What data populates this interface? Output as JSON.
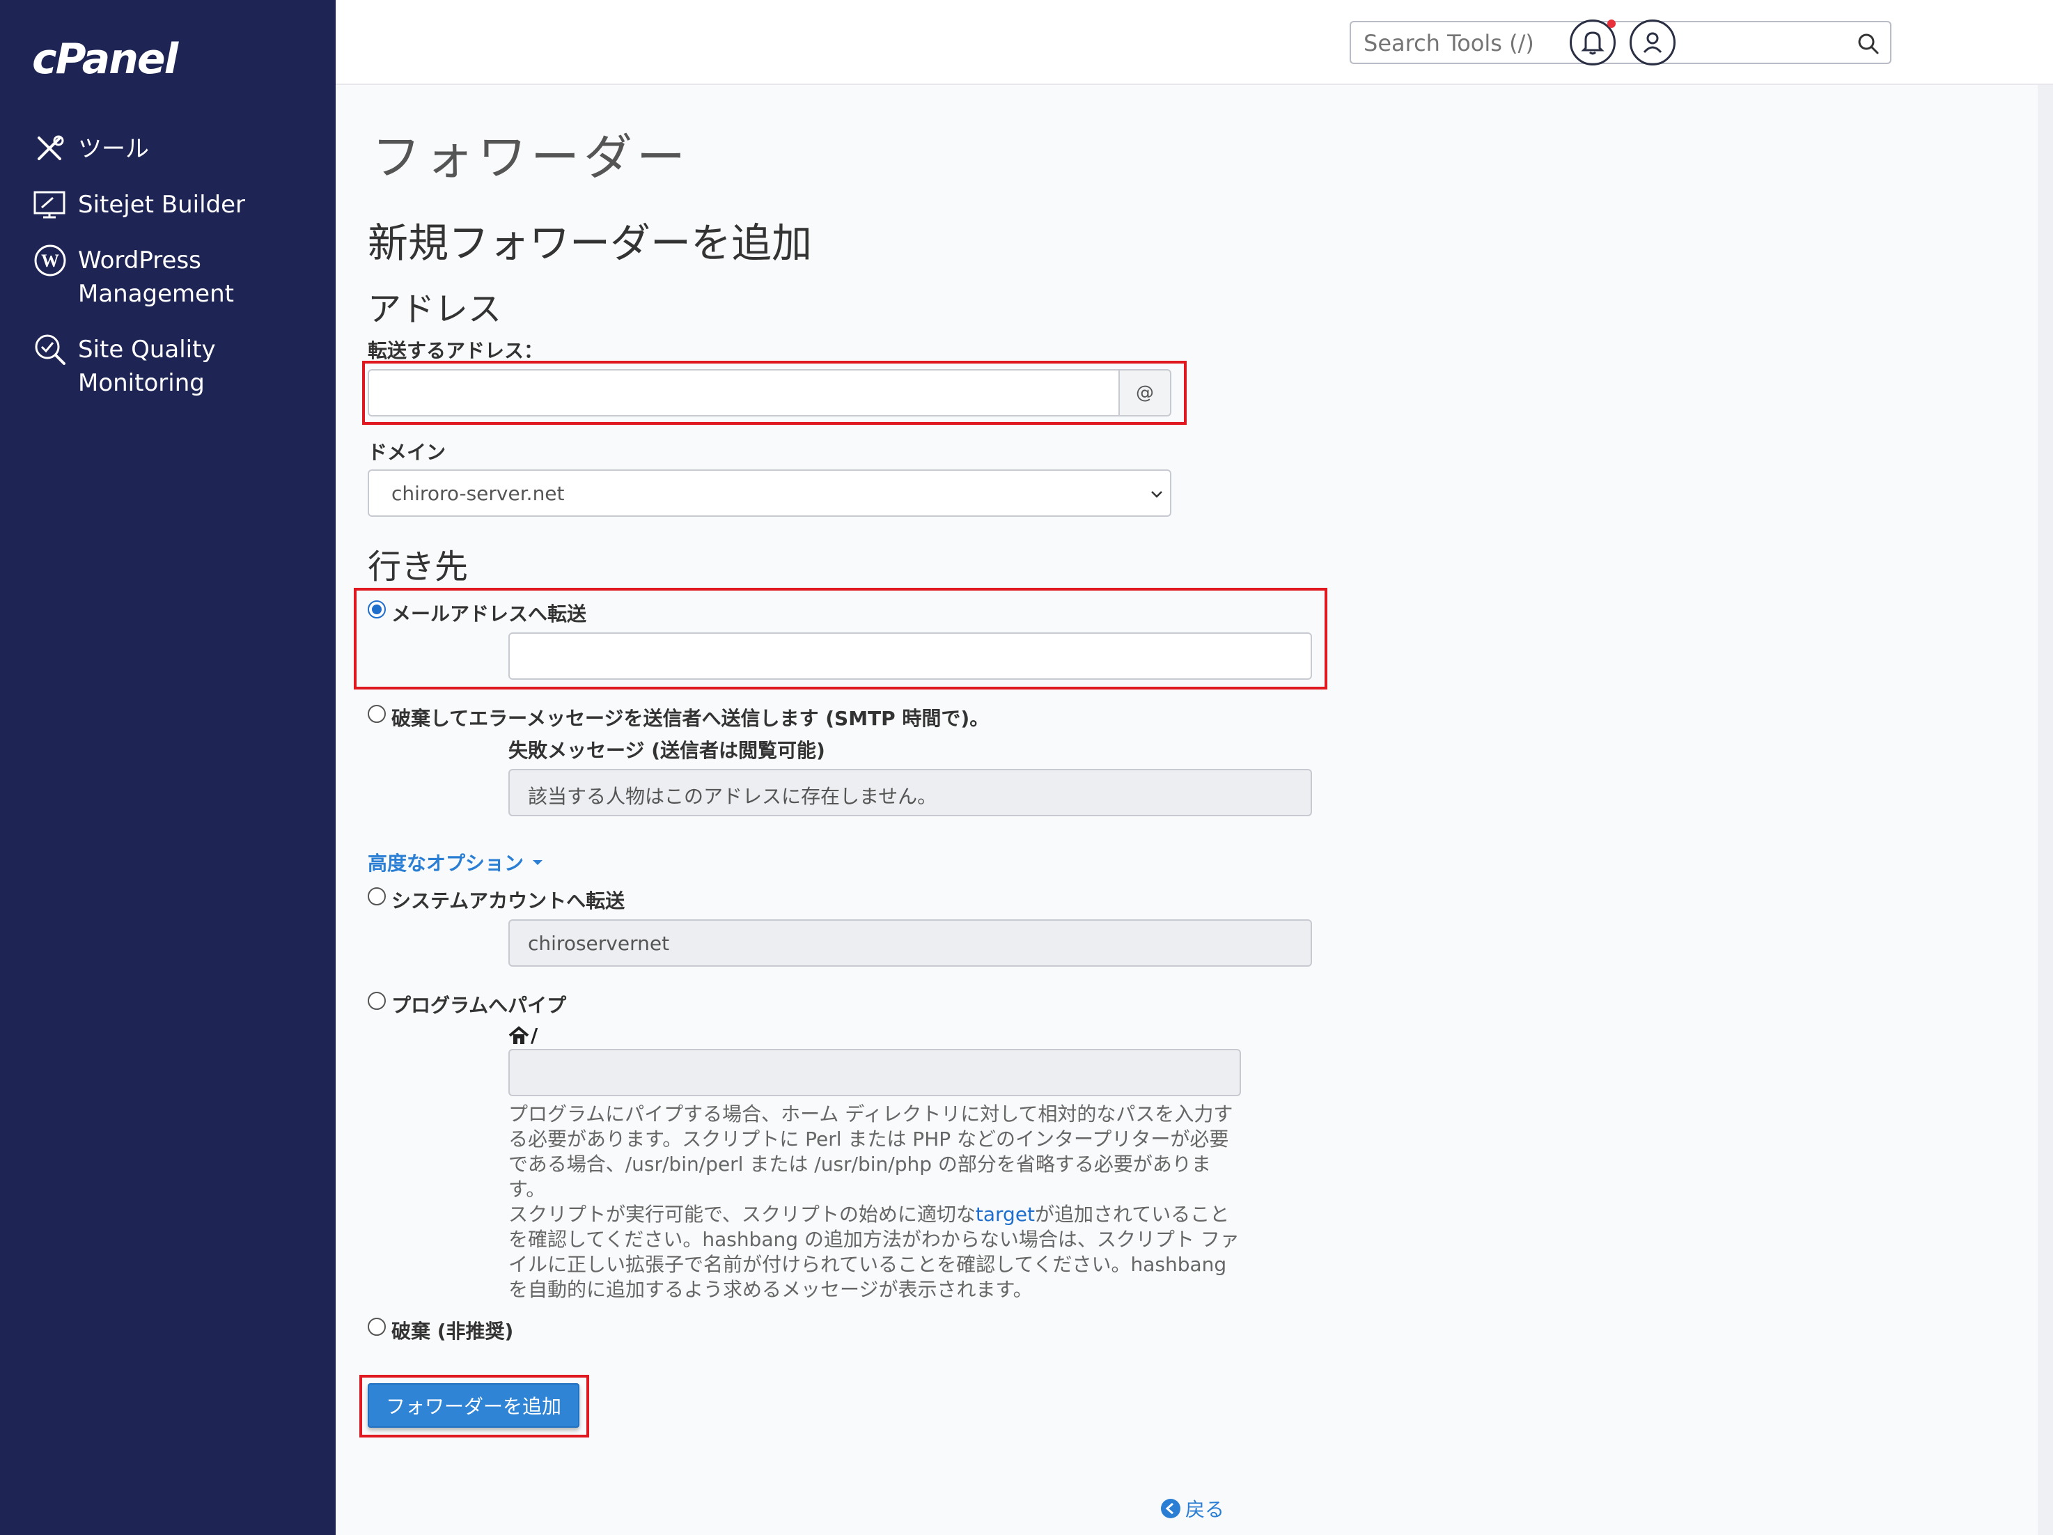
{
  "sidebar": {
    "logo": "cPanel",
    "items": [
      {
        "label": "ツール",
        "icon": "tools-icon"
      },
      {
        "label": "Sitejet Builder",
        "icon": "sitejet-icon"
      },
      {
        "label": "WordPress",
        "label2": "Management",
        "icon": "wordpress-icon"
      },
      {
        "label": "Site Quality",
        "label2": "Monitoring",
        "icon": "site-quality-icon"
      }
    ]
  },
  "header": {
    "search_placeholder": "Search Tools (/)"
  },
  "page": {
    "title": "フォワーダー",
    "section_title": "新規フォワーダーを追加",
    "address_heading": "アドレス",
    "forward_address_label": "転送するアドレス：",
    "forward_address_value": "",
    "at_symbol": "@",
    "domain_label": "ドメイン",
    "domain_selected": "chiroro-server.net",
    "destination_heading": "行き先",
    "options": {
      "forward_email_label": "メールアドレスへ転送",
      "forward_email_value": "",
      "discard_error_label": "破棄してエラーメッセージを送信者へ送信します (SMTP 時間で)。",
      "failure_message_label": "失敗メッセージ (送信者は閲覧可能)",
      "failure_message_value": "該当する人物はこのアドレスに存在しません。",
      "advanced_options_label": "高度なオプション",
      "system_account_label": "システムアカウントへ転送",
      "system_account_value": "chiroservernet",
      "pipe_label": "プログラムへパイプ",
      "pipe_prefix": "/",
      "pipe_help": [
        "プログラムにパイプする場合、ホーム ディレクトリに対して相対的なパスを入力す",
        "る必要があります。スクリプトに Perl または PHP などのインタープリターが必要",
        "である場合、/usr/bin/perl または /usr/bin/php の部分を省略する必要があります。",
        "スクリプトが実行可能で、スクリプトの始めに適切な",
        "target",
        "が追加されていること",
        "を確認してください。hashbang の追加方法がわからない場合は、スクリプト ファ",
        "イルに正しい拡張子で名前が付けられていることを確認してください。hashbang",
        "を自動的に追加するよう求めるメッセージが表示されます。"
      ],
      "discard_label": "破棄 (非推奨)"
    },
    "submit_label": "フォワーダーを追加",
    "back_label": "戻る"
  },
  "colors": {
    "sidebar_bg": "#1e2453",
    "accent": "#2f84d6",
    "highlight_box": "#e0181f"
  }
}
